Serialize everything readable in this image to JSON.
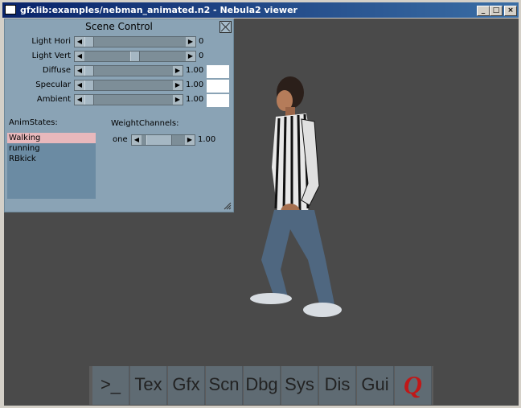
{
  "window": {
    "title": "gfxlib:examples/nebman_animated.n2 - Nebula2 viewer"
  },
  "panel": {
    "title": "Scene Control",
    "sliders": [
      {
        "label": "Light Hori",
        "value": "0",
        "fraction": 0.0
      },
      {
        "label": "Light Vert",
        "value": "0",
        "fraction": 0.5
      },
      {
        "label": "Diffuse",
        "value": "1.00",
        "fraction": 0.0
      },
      {
        "label": "Specular",
        "value": "1.00",
        "fraction": 0.0
      },
      {
        "label": "Ambient",
        "value": "1.00",
        "fraction": 0.0
      }
    ],
    "anim_states_label": "AnimStates:",
    "weight_channels_label": "WeightChannels:",
    "anim_states": [
      "Walking",
      "running",
      "RBkick"
    ],
    "selected_state": "Walking",
    "weight_channel": {
      "label": "one",
      "value": "1.00",
      "fraction": 0.25
    }
  },
  "toolbar": {
    "buttons": [
      ">_",
      "Tex",
      "Gfx",
      "Scn",
      "Dbg",
      "Sys",
      "Dis",
      "Gui",
      "Q"
    ]
  }
}
